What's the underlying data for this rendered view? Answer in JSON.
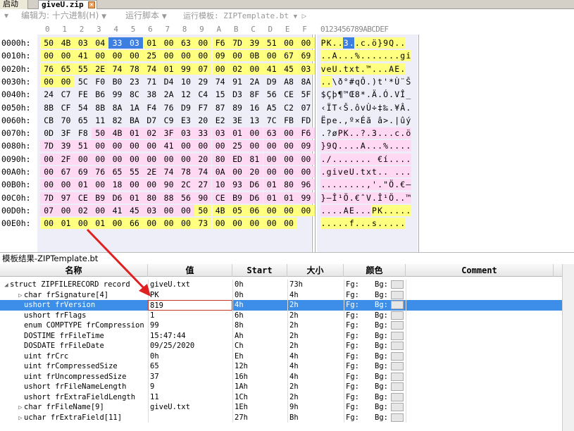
{
  "tabs": {
    "start_label": "启动",
    "file_label": "giveU.zip",
    "close_glyph": "×"
  },
  "toolbar": {
    "edit_as_label": "编辑为: 十六进制(H)",
    "run_script_label": "运行脚本",
    "run_template_label": "运行模板: ZIPTemplate.bt",
    "dropdown_glyph": "▼",
    "play_glyph": "▷",
    "menu_glyph": "▾"
  },
  "hex": {
    "column_headers": [
      "0",
      "1",
      "2",
      "3",
      "4",
      "5",
      "6",
      "7",
      "8",
      "9",
      "A",
      "B",
      "C",
      "D",
      "E",
      "F"
    ],
    "ascii_header": "0123456789ABCDEF",
    "rows": [
      {
        "addr": "0000h:",
        "bytes": [
          "50",
          "4B",
          "03",
          "04",
          "33",
          "03",
          "01",
          "00",
          "63",
          "00",
          "F6",
          "7D",
          "39",
          "51",
          "00",
          "00"
        ],
        "ascii": "PK..3..c.ö}9Q..",
        "hl": [
          "y",
          "y",
          "y",
          "y",
          "s",
          "s",
          "y",
          "y",
          "y",
          "y",
          "y",
          "y",
          "y",
          "y",
          "y",
          "y"
        ]
      },
      {
        "addr": "0010h:",
        "bytes": [
          "00",
          "00",
          "41",
          "00",
          "00",
          "00",
          "25",
          "00",
          "00",
          "00",
          "09",
          "00",
          "0B",
          "00",
          "67",
          "69"
        ],
        "ascii": "..A...%.......gi",
        "hl": [
          "y",
          "y",
          "y",
          "y",
          "y",
          "y",
          "y",
          "y",
          "y",
          "y",
          "y",
          "y",
          "y",
          "y",
          "y",
          "y"
        ]
      },
      {
        "addr": "0020h:",
        "bytes": [
          "76",
          "65",
          "55",
          "2E",
          "74",
          "78",
          "74",
          "01",
          "99",
          "07",
          "00",
          "02",
          "00",
          "41",
          "45",
          "03"
        ],
        "ascii": "veU.txt.™...AE.",
        "hl": [
          "y",
          "y",
          "y",
          "y",
          "y",
          "y",
          "y",
          "y",
          "y",
          "y",
          "y",
          "y",
          "y",
          "y",
          "y",
          "y"
        ]
      },
      {
        "addr": "0030h:",
        "bytes": [
          "00",
          "00",
          "5C",
          "F0",
          "B0",
          "23",
          "71",
          "D4",
          "10",
          "29",
          "74",
          "91",
          "2A",
          "D9",
          "A8",
          "8A"
        ],
        "ascii": "..\\ð°#qÔ.)t'*Ù¨Š",
        "hl": [
          "y",
          "y",
          "",
          "",
          "",
          "",
          "",
          "",
          "",
          "",
          "",
          "",
          "",
          "",
          "",
          ""
        ]
      },
      {
        "addr": "0040h:",
        "bytes": [
          "24",
          "C7",
          "FE",
          "B6",
          "99",
          "8C",
          "38",
          "2A",
          "12",
          "C4",
          "15",
          "D3",
          "8F",
          "56",
          "CE",
          "5F"
        ],
        "ascii": "$Çþ¶™Œ8*.Ä.Ó.VÎ_",
        "hl": [
          "",
          "",
          "",
          "",
          "",
          "",
          "",
          "",
          "",
          "",
          "",
          "",
          "",
          "",
          "",
          ""
        ]
      },
      {
        "addr": "0050h:",
        "bytes": [
          "8B",
          "CF",
          "54",
          "8B",
          "8A",
          "1A",
          "F4",
          "76",
          "D9",
          "F7",
          "87",
          "89",
          "16",
          "A5",
          "C2",
          "07"
        ],
        "ascii": "‹ÏT‹Š.ôvÙ÷‡‰.¥Â.",
        "hl": [
          "",
          "",
          "",
          "",
          "",
          "",
          "",
          "",
          "",
          "",
          "",
          "",
          "",
          "",
          "",
          ""
        ]
      },
      {
        "addr": "0060h:",
        "bytes": [
          "CB",
          "70",
          "65",
          "11",
          "82",
          "BA",
          "D7",
          "C9",
          "E3",
          "20",
          "E2",
          "3E",
          "13",
          "7C",
          "FB",
          "FD"
        ],
        "ascii": "Ëpe.‚º×Éã â>.|ûý",
        "hl": [
          "",
          "",
          "",
          "",
          "",
          "",
          "",
          "",
          "",
          "",
          "",
          "",
          "",
          "",
          "",
          ""
        ]
      },
      {
        "addr": "0070h:",
        "bytes": [
          "0D",
          "3F",
          "F8",
          "50",
          "4B",
          "01",
          "02",
          "3F",
          "03",
          "33",
          "03",
          "01",
          "00",
          "63",
          "00",
          "F6"
        ],
        "ascii": ".?øPK..?.3...c.ö",
        "hl": [
          "",
          "",
          "",
          "p",
          "p",
          "p",
          "p",
          "p",
          "p",
          "p",
          "p",
          "p",
          "p",
          "p",
          "p",
          "p"
        ]
      },
      {
        "addr": "0080h:",
        "bytes": [
          "7D",
          "39",
          "51",
          "00",
          "00",
          "00",
          "00",
          "41",
          "00",
          "00",
          "00",
          "25",
          "00",
          "00",
          "00",
          "09"
        ],
        "ascii": "}9Q....A...%....",
        "hl": [
          "p",
          "p",
          "p",
          "p",
          "p",
          "p",
          "p",
          "p",
          "p",
          "p",
          "p",
          "p",
          "p",
          "p",
          "p",
          "p"
        ]
      },
      {
        "addr": "0090h:",
        "bytes": [
          "00",
          "2F",
          "00",
          "00",
          "00",
          "00",
          "00",
          "00",
          "00",
          "20",
          "80",
          "ED",
          "81",
          "00",
          "00",
          "00"
        ],
        "ascii": "./....... €í....",
        "hl": [
          "p",
          "p",
          "p",
          "p",
          "p",
          "p",
          "p",
          "p",
          "p",
          "p",
          "p",
          "p",
          "p",
          "p",
          "p",
          "p"
        ]
      },
      {
        "addr": "00A0h:",
        "bytes": [
          "00",
          "67",
          "69",
          "76",
          "65",
          "55",
          "2E",
          "74",
          "78",
          "74",
          "0A",
          "00",
          "20",
          "00",
          "00",
          "00"
        ],
        "ascii": ".giveU.txt.. ...",
        "hl": [
          "p",
          "p",
          "p",
          "p",
          "p",
          "p",
          "p",
          "p",
          "p",
          "p",
          "p",
          "p",
          "p",
          "p",
          "p",
          "p"
        ]
      },
      {
        "addr": "00B0h:",
        "bytes": [
          "00",
          "00",
          "01",
          "00",
          "18",
          "00",
          "00",
          "90",
          "2C",
          "27",
          "10",
          "93",
          "D6",
          "01",
          "80",
          "96"
        ],
        "ascii": "........,'.\"Ö.€–",
        "hl": [
          "p",
          "p",
          "p",
          "p",
          "p",
          "p",
          "p",
          "p",
          "p",
          "p",
          "p",
          "p",
          "p",
          "p",
          "p",
          "p"
        ]
      },
      {
        "addr": "00C0h:",
        "bytes": [
          "7D",
          "97",
          "CE",
          "B9",
          "D6",
          "01",
          "80",
          "88",
          "56",
          "90",
          "CE",
          "B9",
          "D6",
          "01",
          "01",
          "99"
        ],
        "ascii": "}—Î¹Ö.€ˆV.Î¹Ö..™",
        "hl": [
          "p",
          "p",
          "p",
          "p",
          "p",
          "p",
          "p",
          "p",
          "p",
          "p",
          "p",
          "p",
          "p",
          "p",
          "p",
          "p"
        ]
      },
      {
        "addr": "00D0h:",
        "bytes": [
          "07",
          "00",
          "02",
          "00",
          "41",
          "45",
          "03",
          "00",
          "00",
          "50",
          "4B",
          "05",
          "06",
          "00",
          "00",
          "00"
        ],
        "ascii": "....AE...PK.....",
        "hl": [
          "p",
          "p",
          "p",
          "p",
          "p",
          "p",
          "p",
          "p",
          "p",
          "y",
          "y",
          "y",
          "y",
          "y",
          "y",
          "y"
        ]
      },
      {
        "addr": "00E0h:",
        "bytes": [
          "00",
          "01",
          "00",
          "01",
          "00",
          "66",
          "00",
          "00",
          "00",
          "73",
          "00",
          "00",
          "00",
          "00",
          "00",
          ""
        ],
        "ascii": ".....f...s.....",
        "hl": [
          "y",
          "y",
          "y",
          "y",
          "y",
          "y",
          "y",
          "y",
          "y",
          "y",
          "y",
          "y",
          "y",
          "y",
          "y",
          ""
        ]
      }
    ]
  },
  "results": {
    "title": "模板结果-ZIPTemplate.bt",
    "headers": {
      "name": "名称",
      "value": "值",
      "start": "Start",
      "size": "大小",
      "color": "颜色",
      "comment": "Comment"
    },
    "fg_label": "Fg:",
    "bg_label": "Bg:",
    "rows": [
      {
        "indent": 0,
        "twisty": "◢",
        "name": "struct ZIPFILERECORD record",
        "value": "giveU.txt",
        "start": "0h",
        "size": "73h"
      },
      {
        "indent": 1,
        "twisty": "▷",
        "name": "char frSignature[4]",
        "value": "PK",
        "start": "0h",
        "size": "4h"
      },
      {
        "indent": 1,
        "twisty": "",
        "name": "ushort frVersion",
        "value": "819",
        "start": "4h",
        "size": "2h",
        "selected": true
      },
      {
        "indent": 1,
        "twisty": "",
        "name": "ushort frFlags",
        "value": "1",
        "start": "6h",
        "size": "2h"
      },
      {
        "indent": 1,
        "twisty": "",
        "name": "enum COMPTYPE frCompression",
        "value": "99",
        "start": "8h",
        "size": "2h"
      },
      {
        "indent": 1,
        "twisty": "",
        "name": "DOSTIME frFileTime",
        "value": "15:47:44",
        "start": "Ah",
        "size": "2h"
      },
      {
        "indent": 1,
        "twisty": "",
        "name": "DOSDATE frFileDate",
        "value": "09/25/2020",
        "start": "Ch",
        "size": "2h"
      },
      {
        "indent": 1,
        "twisty": "",
        "name": "uint frCrc",
        "value": "0h",
        "start": "Eh",
        "size": "4h"
      },
      {
        "indent": 1,
        "twisty": "",
        "name": "uint frCompressedSize",
        "value": "65",
        "start": "12h",
        "size": "4h"
      },
      {
        "indent": 1,
        "twisty": "",
        "name": "uint frUncompressedSize",
        "value": "37",
        "start": "16h",
        "size": "4h"
      },
      {
        "indent": 1,
        "twisty": "",
        "name": "ushort frFileNameLength",
        "value": "9",
        "start": "1Ah",
        "size": "2h"
      },
      {
        "indent": 1,
        "twisty": "",
        "name": "ushort frExtraFieldLength",
        "value": "11",
        "start": "1Ch",
        "size": "2h"
      },
      {
        "indent": 1,
        "twisty": "▷",
        "name": "char frFileName[9]",
        "value": "giveU.txt",
        "start": "1Eh",
        "size": "9h"
      },
      {
        "indent": 1,
        "twisty": "▷",
        "name": "uchar frExtraField[11]",
        "value": "",
        "start": "27h",
        "size": "Bh"
      }
    ]
  },
  "colors": {
    "highlight_yellow": "#ffff80",
    "highlight_pink": "#ffd8f4",
    "selection_blue": "#3d8ee8",
    "arrow_red": "#e02020"
  }
}
